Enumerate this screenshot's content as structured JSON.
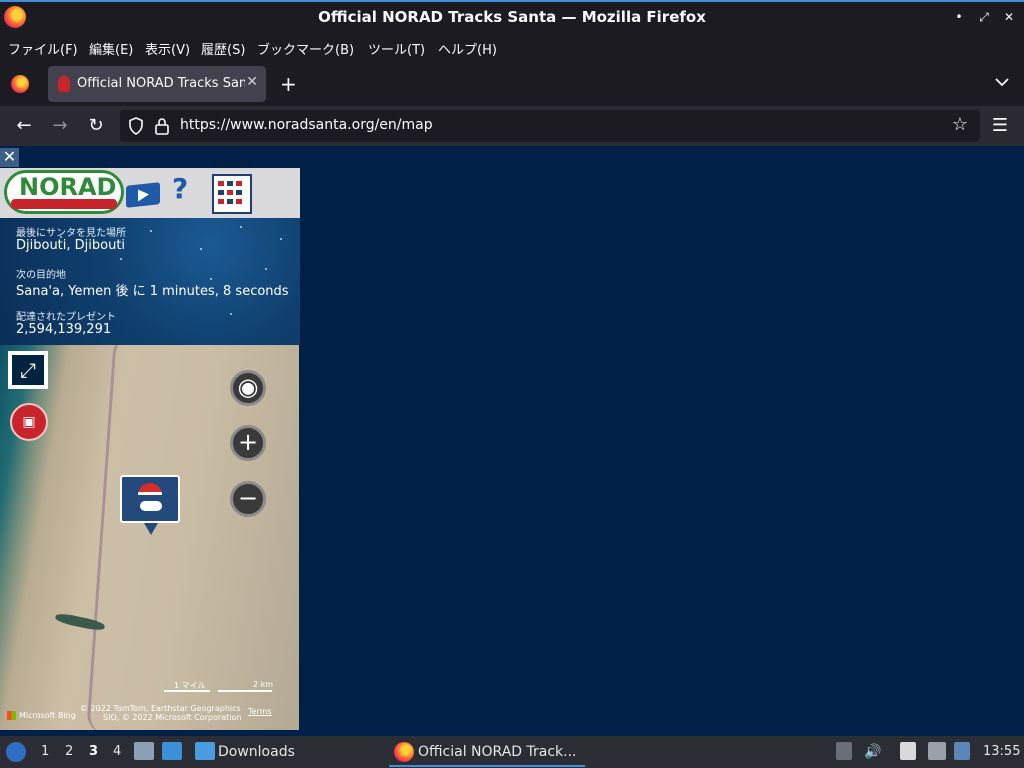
{
  "window": {
    "title": "Official NORAD Tracks Santa — Mozilla Firefox"
  },
  "menu": {
    "items": [
      "ファイル(F)",
      "編集(E)",
      "表示(V)",
      "履歴(S)",
      "ブックマーク(B)",
      "ツール(T)",
      "ヘルプ(H)"
    ]
  },
  "tabs": {
    "active_label": "Official NORAD Tracks Santa",
    "new_tab": "+"
  },
  "nav": {
    "url": "https://www.noradsanta.org/en/map"
  },
  "norad": {
    "logo_text": "NORAD",
    "help_text": "?",
    "last_seen_label": "最後にサンタを見た場所",
    "last_seen_value": "Djibouti, Djibouti",
    "next_label": "次の目的地",
    "next_value": "Sana'a, Yemen 後 に 1 minutes, 8 seconds",
    "gifts_label": "配達されたプレゼント",
    "gifts_value": "2,594,139,291"
  },
  "map": {
    "scale_miles": "1 マイル",
    "scale_km": "2 km",
    "attribution_line1": "© 2022 TomTom, Earthstar Geographics",
    "attribution_line2": "SIO, © 2022 Microsoft Corporation",
    "terms": "Terms",
    "bing": "Microsoft Bing"
  },
  "taskbar": {
    "workspaces": [
      "1",
      "2",
      "3",
      "4"
    ],
    "active_workspace": "3",
    "downloads_label": "Downloads",
    "firefox_task": "Official NORAD Track...",
    "clock": "13:55"
  },
  "colors": {
    "accent": "#3d8fd8",
    "page_background": "#002047",
    "chrome_dark": "#1c1b22"
  }
}
